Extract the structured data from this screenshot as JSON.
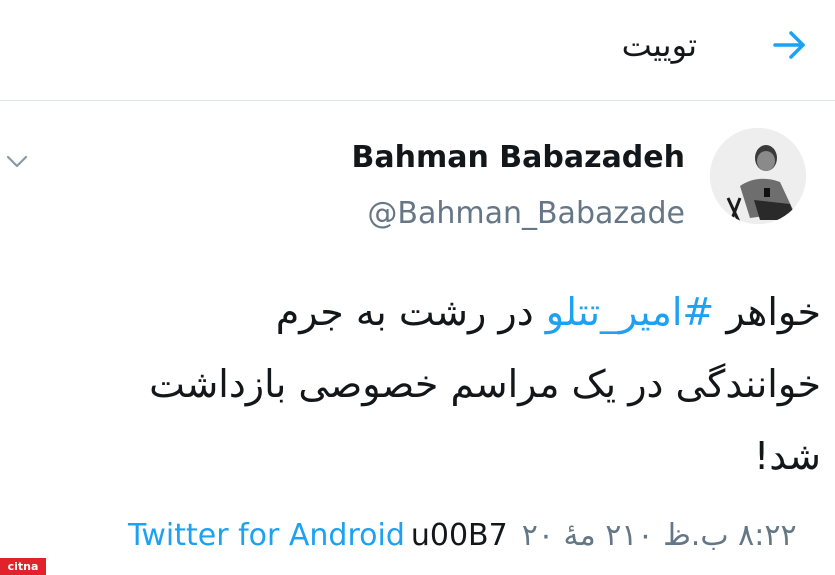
{
  "header": {
    "title": "توییت",
    "back_icon": "arrow-right-icon"
  },
  "tweet": {
    "display_name": "Bahman Babazadeh",
    "handle": "@Bahman_Babazade",
    "menu_icon": "chevron-down-icon",
    "text_line1_prefix": "خواهر ",
    "hashtag": "#امیر_تتلو",
    "text_line1_suffix": " در رشت به جرم",
    "text_line2": "خوانندگی در یک مراسم خصوصی بازداشت",
    "text_line3": "شد!",
    "source": "Twitter for Android",
    "separator": "u00B7",
    "timestamp": "۸:۲۲ ب.ظ ۲۱۰ مهٔ ۲۰"
  },
  "colors": {
    "accent": "#1da1f2",
    "secondary_text": "#657786",
    "divider": "#dfe6ea"
  },
  "watermark": {
    "label": "citna"
  }
}
